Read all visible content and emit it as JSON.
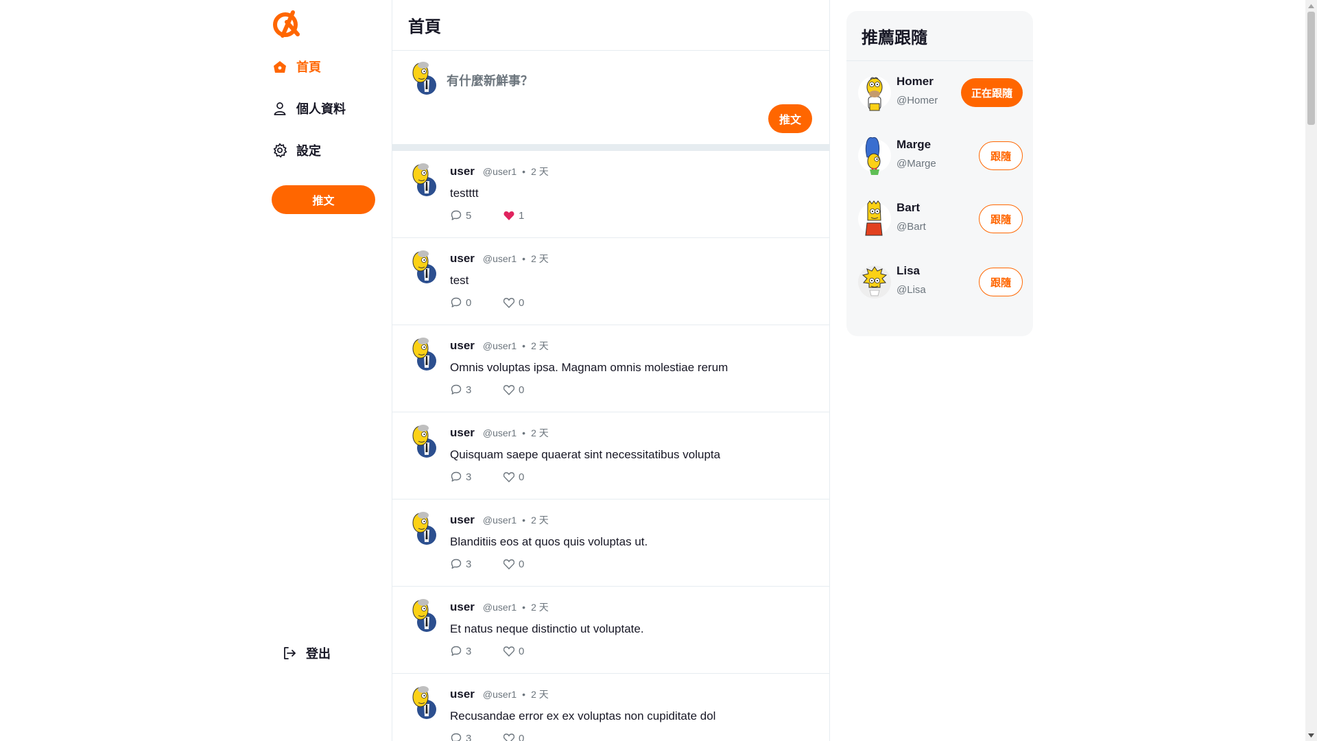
{
  "brand": {
    "accent": "#ff6600",
    "logo_icon": "alphitter-logo-icon"
  },
  "nav": {
    "items": [
      {
        "label": "首頁",
        "icon": "home-icon",
        "active": true
      },
      {
        "label": "個人資料",
        "icon": "user-icon",
        "active": false
      },
      {
        "label": "設定",
        "icon": "gear-icon",
        "active": false
      }
    ],
    "tweet_button": "推文",
    "logout": {
      "label": "登出",
      "icon": "logout-icon"
    }
  },
  "main": {
    "title": "首頁",
    "composer": {
      "placeholder": "有什麼新鮮事？",
      "button": "推文"
    },
    "tweets": [
      {
        "name": "user",
        "handle": "@user1",
        "time": "2 天",
        "content": "testttt",
        "replies": "5",
        "likes": "1",
        "liked": true
      },
      {
        "name": "user",
        "handle": "@user1",
        "time": "2 天",
        "content": "test",
        "replies": "0",
        "likes": "0",
        "liked": false
      },
      {
        "name": "user",
        "handle": "@user1",
        "time": "2 天",
        "content": "Omnis voluptas ipsa. Magnam omnis molestiae rerum",
        "replies": "3",
        "likes": "0",
        "liked": false
      },
      {
        "name": "user",
        "handle": "@user1",
        "time": "2 天",
        "content": "Quisquam saepe quaerat sint necessitatibus volupta",
        "replies": "3",
        "likes": "0",
        "liked": false
      },
      {
        "name": "user",
        "handle": "@user1",
        "time": "2 天",
        "content": "Blanditiis eos at quos quis voluptas ut.",
        "replies": "3",
        "likes": "0",
        "liked": false
      },
      {
        "name": "user",
        "handle": "@user1",
        "time": "2 天",
        "content": "Et natus neque distinctio ut voluptate.",
        "replies": "3",
        "likes": "0",
        "liked": false
      },
      {
        "name": "user",
        "handle": "@user1",
        "time": "2 天",
        "content": "Recusandae error ex ex voluptas non cupiditate dol",
        "replies": "3",
        "likes": "0",
        "liked": false
      }
    ]
  },
  "suggestions": {
    "title": "推薦跟隨",
    "users": [
      {
        "name": "Homer",
        "handle": "@Homer",
        "button": "正在跟隨",
        "following": true
      },
      {
        "name": "Marge",
        "handle": "@Marge",
        "button": "跟隨",
        "following": false
      },
      {
        "name": "Bart",
        "handle": "@Bart",
        "button": "跟隨",
        "following": false
      },
      {
        "name": "Lisa",
        "handle": "@Lisa",
        "button": "跟隨",
        "following": false
      }
    ]
  }
}
